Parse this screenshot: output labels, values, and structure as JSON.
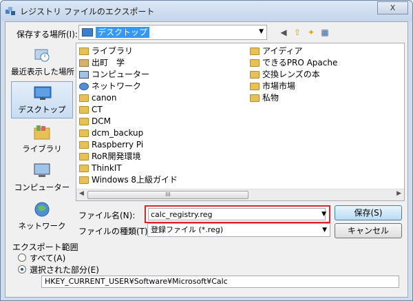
{
  "window": {
    "title": "レジストリ ファイルのエクスポート",
    "close_label": "X"
  },
  "save_in": {
    "label": "保存する場所(I):",
    "value": "デスクトップ"
  },
  "places": [
    {
      "label": "最近表示した場所",
      "icon": "recent-places-icon"
    },
    {
      "label": "デスクトップ",
      "icon": "desktop-icon",
      "selected": true
    },
    {
      "label": "ライブラリ",
      "icon": "libraries-icon"
    },
    {
      "label": "コンピューター",
      "icon": "computer-icon"
    },
    {
      "label": "ネットワーク",
      "icon": "network-icon"
    }
  ],
  "files": {
    "col1": [
      {
        "name": "ライブラリ",
        "icon": "libraries-icon"
      },
      {
        "name": "出町　学",
        "icon": "user-folder-icon"
      },
      {
        "name": "コンピューター",
        "icon": "computer-icon"
      },
      {
        "name": "ネットワーク",
        "icon": "network-icon"
      },
      {
        "name": "canon",
        "icon": "folder-icon"
      },
      {
        "name": "CT",
        "icon": "folder-icon"
      },
      {
        "name": "DCM",
        "icon": "folder-icon"
      },
      {
        "name": "dcm_backup",
        "icon": "folder-icon"
      },
      {
        "name": "Raspberry Pi",
        "icon": "folder-icon"
      },
      {
        "name": "RoR開発環境",
        "icon": "folder-icon"
      },
      {
        "name": "ThinkIT",
        "icon": "folder-icon"
      },
      {
        "name": "Windows 8上級ガイド",
        "icon": "folder-icon"
      }
    ],
    "col2": [
      {
        "name": "アイディア",
        "icon": "folder-icon"
      },
      {
        "name": "できるPRO Apache",
        "icon": "folder-icon"
      },
      {
        "name": "交換レンズの本",
        "icon": "folder-icon"
      },
      {
        "name": "市場市場",
        "icon": "folder-icon"
      },
      {
        "name": "私物",
        "icon": "folder-icon"
      }
    ]
  },
  "scrollbar_thumb_glyph": "III",
  "filename": {
    "label": "ファイル名(N):",
    "value": "calc_registry.reg"
  },
  "filetype": {
    "label": "ファイルの種類(T):",
    "value": "登録ファイル (*.reg)"
  },
  "buttons": {
    "save": "保存(S)",
    "cancel": "キャンセル"
  },
  "export_range": {
    "label": "エクスポート範囲",
    "all": "すべて(A)",
    "selected": "選択された部分(E)",
    "selected_on": true,
    "key_path": "HKEY_CURRENT_USER¥Software¥Microsoft¥Calc"
  },
  "colors": {
    "highlight_box": "#e0232b",
    "selection": "#3399ff"
  }
}
